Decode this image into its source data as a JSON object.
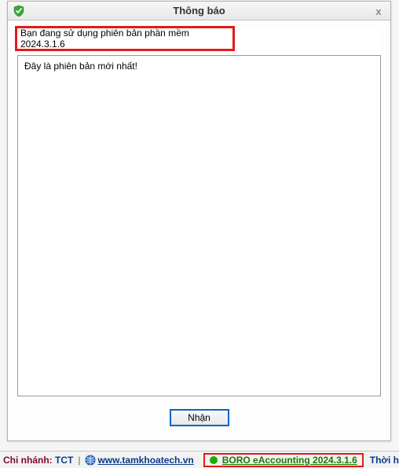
{
  "dialog": {
    "title": "Thông báo",
    "close_label": "x",
    "version_text": "Bạn đang sử dụng phiên bản phần mềm 2024.3.1.6",
    "message": "Đây là phiên bản mới nhất!",
    "ok_label": "Nhận"
  },
  "status": {
    "branch_label": "Chi nhánh:",
    "branch_value": "TCT",
    "separator": "|",
    "site_link": "www.tamkhoatech.vn",
    "app_name": "BORO eAccounting 2024.3.1.6",
    "trailing": "Thời hạ"
  }
}
